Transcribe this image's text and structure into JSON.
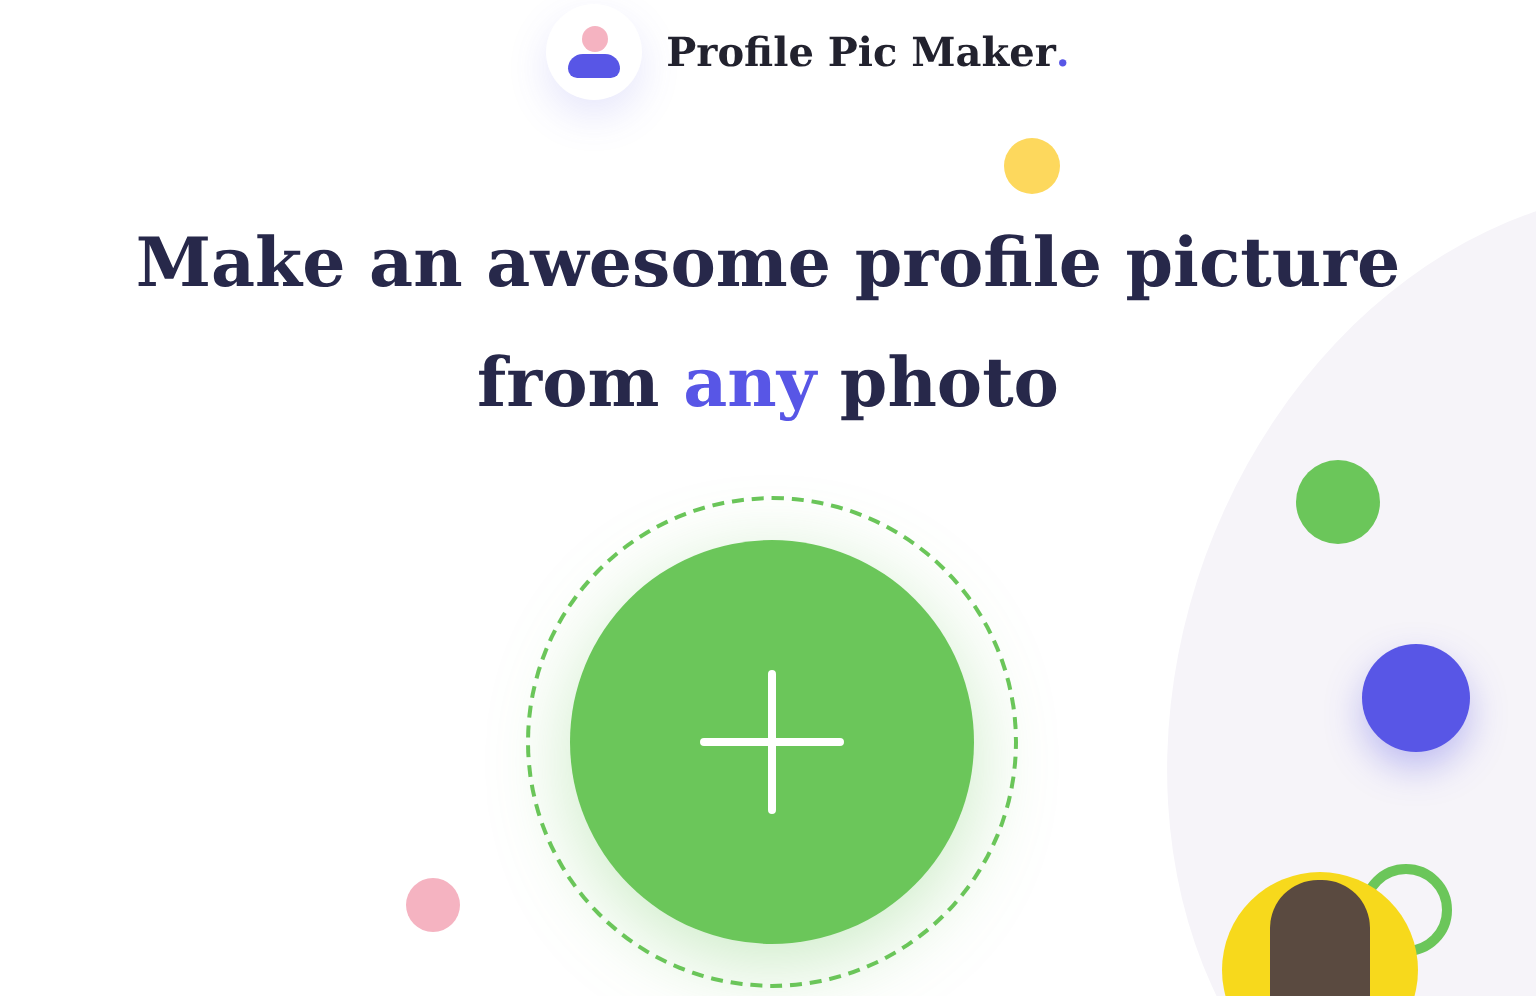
{
  "header": {
    "brand": "Profile Pic Maker",
    "brand_mark": "."
  },
  "headline": [
    [
      {
        "text": "Make an awesome profile picture",
        "highlight": false
      }
    ],
    [
      {
        "text": "from ",
        "highlight": false
      },
      {
        "text": "any",
        "highlight": true
      },
      {
        "text": " photo",
        "highlight": false
      }
    ]
  ]
}
